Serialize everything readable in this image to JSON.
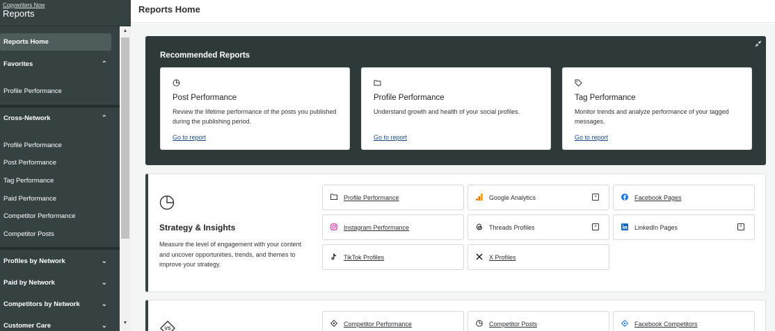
{
  "sidebar": {
    "org": "Copywriters Now",
    "app": "Reports",
    "home": "Reports Home",
    "favorites": {
      "label": "Favorites",
      "items": [
        "Profile Performance"
      ]
    },
    "cross_network": {
      "label": "Cross-Network",
      "items": [
        "Profile Performance",
        "Post Performance",
        "Tag Performance",
        "Paid Performance",
        "Competitor Performance",
        "Competitor Posts"
      ]
    },
    "collapsed_sections": [
      "Profiles by Network",
      "Paid by Network",
      "Competitors by Network",
      "Customer Care"
    ]
  },
  "header": {
    "title": "Reports Home"
  },
  "recommended": {
    "title": "Recommended Reports",
    "cards": [
      {
        "icon": "pie-chart-icon",
        "title": "Post Performance",
        "desc": "Review the lifetime performance of the posts you published during the publishing period.",
        "link": "Go to report"
      },
      {
        "icon": "folder-icon",
        "title": "Profile Performance",
        "desc": "Understand growth and health of your social profiles.",
        "link": "Go to report"
      },
      {
        "icon": "tag-icon",
        "title": "Tag Performance",
        "desc": "Monitor trends and analyze performance of your tagged messages.",
        "link": "Go to report"
      }
    ]
  },
  "strategy": {
    "title": "Strategy & Insights",
    "desc": "Measure the level of engagement with your content and uncover opportunities, trends, and themes to improve your strategy.",
    "links": [
      {
        "label": "Profile Performance",
        "icon": "folder-icon",
        "external": false
      },
      {
        "label": "Google Analytics",
        "icon": "google-analytics-icon",
        "external": true
      },
      {
        "label": "Facebook Pages",
        "icon": "facebook-icon",
        "external": false
      },
      {
        "label": "Instagram Performance",
        "icon": "instagram-icon",
        "external": false
      },
      {
        "label": "Threads Profiles",
        "icon": "threads-icon",
        "external": true
      },
      {
        "label": "LinkedIn Pages",
        "icon": "linkedin-icon",
        "external": true
      },
      {
        "label": "TikTok Profiles",
        "icon": "tiktok-icon",
        "external": false
      },
      {
        "label": "X Profiles",
        "icon": "x-icon",
        "external": false
      }
    ]
  },
  "competitive": {
    "links": [
      {
        "label": "Competitor Performance",
        "icon": "competitor-icon"
      },
      {
        "label": "Competitor Posts",
        "icon": "pie-chart-icon"
      },
      {
        "label": "Facebook Competitors",
        "icon": "facebook-competitor-icon"
      }
    ]
  }
}
